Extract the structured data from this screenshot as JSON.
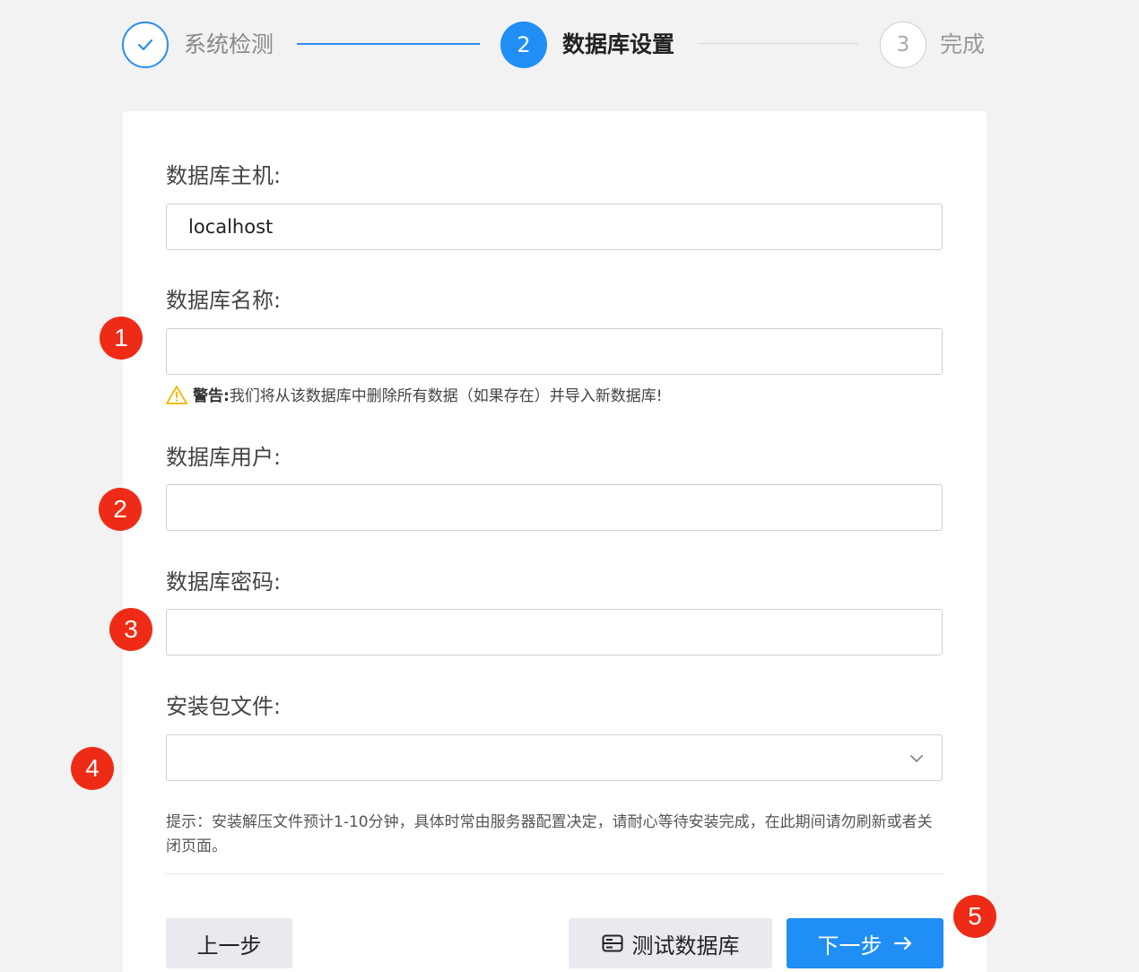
{
  "steps": [
    {
      "number": "1",
      "label": "系统检测",
      "state": "done"
    },
    {
      "number": "2",
      "label": "数据库设置",
      "state": "active"
    },
    {
      "number": "3",
      "label": "完成",
      "state": "pending"
    }
  ],
  "form": {
    "host": {
      "label": "数据库主机:",
      "value": "localhost"
    },
    "name": {
      "label": "数据库名称:",
      "value": ""
    },
    "user": {
      "label": "数据库用户:",
      "value": ""
    },
    "password": {
      "label": "数据库密码:",
      "value": ""
    },
    "package": {
      "label": "安装包文件:",
      "value": ""
    }
  },
  "warning": {
    "title": "警告:",
    "text": "我们将从该数据库中删除所有数据（如果存在）并导入新数据库!"
  },
  "hint": "提示：安装解压文件预计1-10分钟，具体时常由服务器配置决定，请耐心等待安装完成，在此期间请勿刷新或者关闭页面。",
  "buttons": {
    "prev": "上一步",
    "test": "测试数据库",
    "next": "下一步"
  },
  "markers": [
    "1",
    "2",
    "3",
    "4",
    "5"
  ],
  "colors": {
    "primary": "#1f8ff5",
    "marker": "#ee2b16",
    "warning": "#f5b800"
  }
}
